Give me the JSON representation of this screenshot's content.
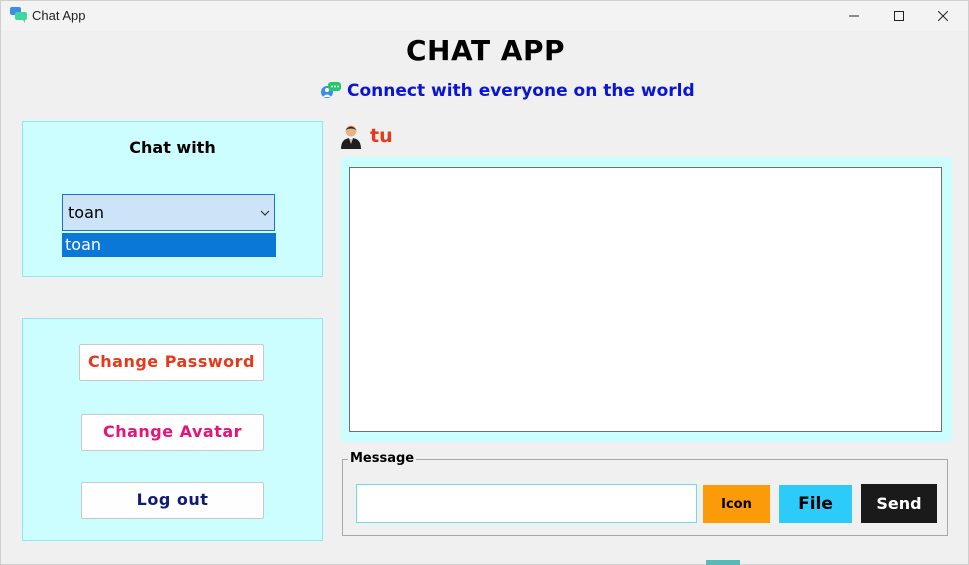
{
  "window": {
    "title": "Chat App",
    "icon": "chat-bubbles-icon"
  },
  "header": {
    "title": "CHAT APP",
    "subtitle": "Connect with everyone on the world",
    "subtitle_icon": "people-chat-icon"
  },
  "chat_with": {
    "label": "Chat with",
    "selected": "toan",
    "options": [
      "toan"
    ]
  },
  "account": {
    "change_password": "Change Password",
    "change_avatar": "Change Avatar",
    "log_out": "Log out"
  },
  "user": {
    "name": "tu",
    "avatar": "user-avatar-icon"
  },
  "message": {
    "legend": "Message",
    "value": "",
    "icon_label": "Icon",
    "file_label": "File",
    "send_label": "Send"
  },
  "colors": {
    "panel_bg": "#ccfeff",
    "subtitle": "#0a14d6",
    "username": "#e8381b",
    "icon_btn": "#fb9b0a",
    "file_btn": "#2ccbfa",
    "send_btn": "#1a1a1a",
    "combo_highlight": "#0a78d6"
  }
}
